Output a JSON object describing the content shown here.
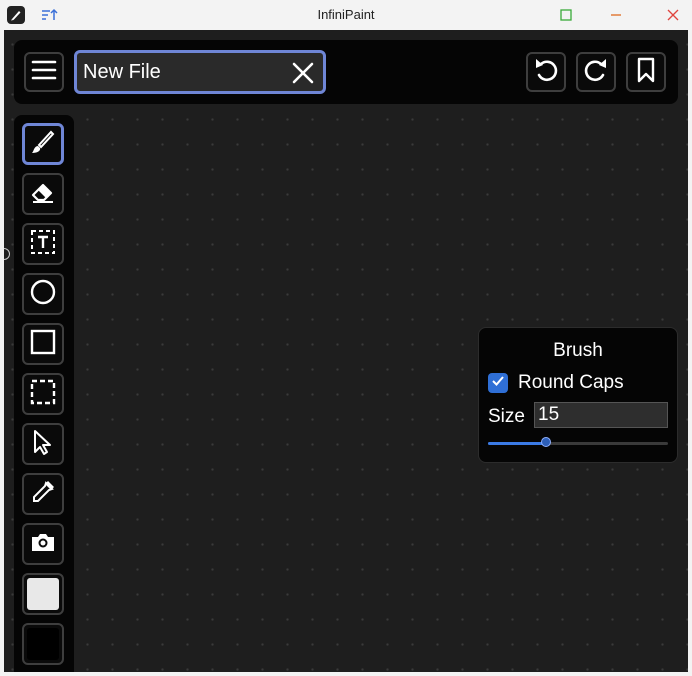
{
  "window": {
    "title": "InfiniPaint",
    "colors": {
      "close": "#e0443e",
      "maximize": "#3aaa3a",
      "minimize": "#e06b1f"
    }
  },
  "topbar": {
    "filename_value": "New File",
    "menu_icon": "hamburger-menu-icon",
    "clear_icon": "close-x-icon",
    "buttons": [
      "undo-icon",
      "redo-icon",
      "bookmark-icon"
    ]
  },
  "toolbar": {
    "tools": [
      "brush-icon",
      "eraser-icon",
      "text-box-icon",
      "circle-icon",
      "rectangle-icon",
      "selection-icon",
      "pointer-icon",
      "eyedropper-icon",
      "camera-icon"
    ],
    "active_tool": "brush-icon",
    "primary_color": "#e8e8e8",
    "secondary_color": "#000000",
    "accent_color": "#6f86d6"
  },
  "brush_panel": {
    "title": "Brush",
    "round_caps_label": "Round Caps",
    "round_caps_checked": true,
    "size_label": "Size",
    "size_value": "15",
    "slider_fraction": 0.32
  }
}
